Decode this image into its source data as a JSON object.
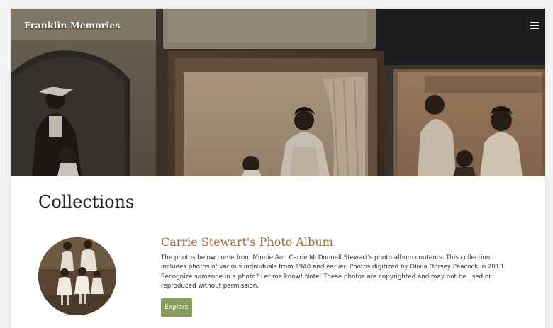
{
  "site": {
    "brand": "Franklin Memories"
  },
  "header": {
    "menu_icon": "hamburger-menu-icon"
  },
  "main": {
    "heading": "Collections",
    "collections": [
      {
        "title": "Carrie Stewart's Photo Album",
        "description": "The photos below come from Minnie Ann Carrie McDonnell Stewart's photo album contents. This collection includes photos of various individuals from 1940 and earlier. Photos digitized by Olivia Dorsey Peacock in 2013. Recognize someone in a photo? Let me know! Note: These photos are copyrighted and may not be used or reproduced without permission.",
        "button_label": "Explore"
      }
    ]
  },
  "colors": {
    "accent_title": "#9a6a43",
    "button_bg": "#8a9b5f",
    "text": "#333333",
    "page_bg": "#ffffff"
  }
}
